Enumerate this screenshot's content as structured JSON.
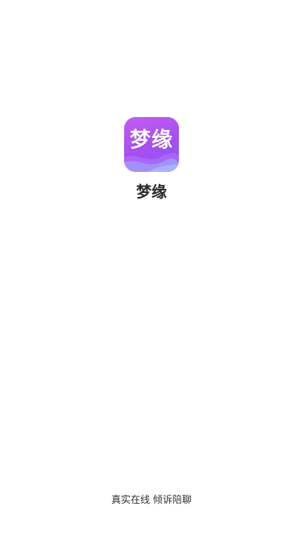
{
  "app": {
    "icon_text": "梦缘",
    "name": "梦缘",
    "icon_name": "app-logo-icon"
  },
  "footer": {
    "slogan": "真实在线  倾诉陪聊"
  },
  "colors": {
    "background": "#ffffff",
    "icon_gradient_start": "#c45df0",
    "icon_gradient_end": "#8c5cf5",
    "wave_accent": "#9fb4ff",
    "title_text": "#2a2a2a",
    "slogan_text": "#333333"
  }
}
